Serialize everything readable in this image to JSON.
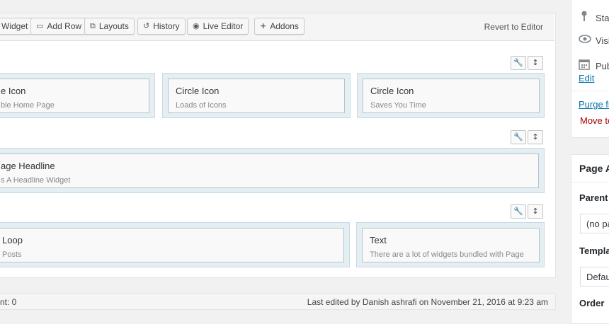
{
  "toolbar": {
    "buttons": [
      {
        "label": "Widget",
        "icon": "widget-icon",
        "glyph": ""
      },
      {
        "label": "Add Row",
        "icon": "add-row-icon",
        "glyph": "▭"
      },
      {
        "label": "Layouts",
        "icon": "layouts-icon",
        "glyph": "⧉"
      },
      {
        "label": "History",
        "icon": "history-icon",
        "glyph": "↺"
      },
      {
        "label": "Live Editor",
        "icon": "eye-icon",
        "glyph": "◉"
      },
      {
        "label": "Addons",
        "icon": "plus-icon",
        "glyph": "+"
      }
    ],
    "revert": "Revert to Editor"
  },
  "row_controls": {
    "settings_glyph": "🔧",
    "move_glyph": "↕"
  },
  "rows": [
    {
      "widgets": [
        {
          "title": "e Icon",
          "desc": "ble Home Page"
        },
        {
          "title": "Circle Icon",
          "desc": "Loads of Icons"
        },
        {
          "title": "Circle Icon",
          "desc": "Saves You Time"
        }
      ]
    },
    {
      "widgets": [
        {
          "title": "age Headline",
          "desc": "s A Headline Widget"
        }
      ]
    },
    {
      "widgets": [
        {
          "title": "Loop",
          "desc": "Posts"
        },
        {
          "title": "Text",
          "desc": "There are a lot of widgets bundled with Page"
        }
      ]
    }
  ],
  "footer": {
    "word_count": "nt: 0",
    "last_edited": "Last edited by Danish ashrafi on November 21, 2016 at 9:23 am"
  },
  "publish": {
    "status": "Sta",
    "visibility": "Visi",
    "published": "Pub",
    "edit": "Edit",
    "purge": "Purge fr",
    "trash": "Move to"
  },
  "page_attributes": {
    "title": "Page A",
    "parent_label": "Parent",
    "parent_value": "(no pa",
    "template_label": "Templa",
    "template_value": "Defau",
    "order_label": "Order"
  },
  "colors": {
    "link": "#0073aa",
    "trash": "#aa0000",
    "cell": "#e4eef3"
  }
}
